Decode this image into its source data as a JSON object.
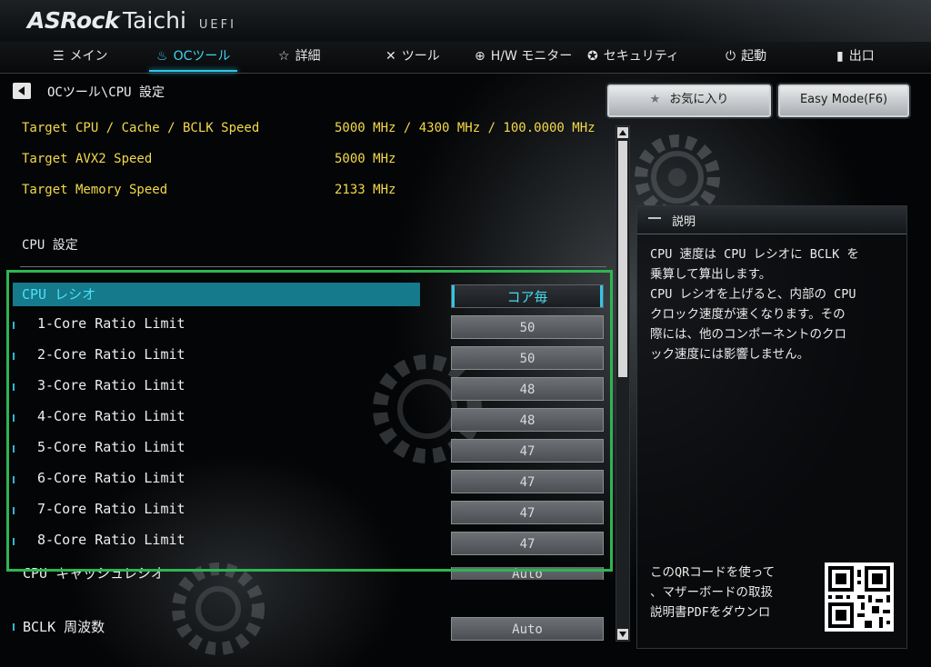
{
  "header": {
    "brand": "ASRock",
    "model": "Taichi",
    "firmware": "UEFI"
  },
  "nav": {
    "tabs": [
      {
        "label": "メイン",
        "icon": "list-icon"
      },
      {
        "label": "OCツール",
        "icon": "flame-icon",
        "active": true
      },
      {
        "label": "詳細",
        "icon": "star-icon"
      },
      {
        "label": "ツール",
        "icon": "tools-icon"
      },
      {
        "label": "H/W モニター",
        "icon": "crosshair-icon"
      },
      {
        "label": "セキュリティ",
        "icon": "shield-icon"
      },
      {
        "label": "起動",
        "icon": "power-icon"
      },
      {
        "label": "出口",
        "icon": "exit-icon"
      }
    ]
  },
  "breadcrumb": "OCツール\\CPU 設定",
  "buttons": {
    "favorites": "お気に入り",
    "easy_mode": "Easy Mode(F6)"
  },
  "info": [
    {
      "label": "Target CPU / Cache / BCLK Speed",
      "value": "5000 MHz / 4300 MHz / 100.0000 MHz"
    },
    {
      "label": "Target AVX2 Speed",
      "value": "5000 MHz"
    },
    {
      "label": "Target Memory Speed",
      "value": "2133 MHz"
    }
  ],
  "section_title": "CPU 設定",
  "settings": [
    {
      "label": "CPU レシオ",
      "value": "コア毎"
    },
    {
      "label": "1-Core Ratio Limit",
      "value": "50"
    },
    {
      "label": "2-Core Ratio Limit",
      "value": "50"
    },
    {
      "label": "3-Core Ratio Limit",
      "value": "48"
    },
    {
      "label": "4-Core Ratio Limit",
      "value": "48"
    },
    {
      "label": "5-Core Ratio Limit",
      "value": "47"
    },
    {
      "label": "6-Core Ratio Limit",
      "value": "47"
    },
    {
      "label": "7-Core Ratio Limit",
      "value": "47"
    },
    {
      "label": "8-Core Ratio Limit",
      "value": "47"
    },
    {
      "label": "CPU キャッシュレシオ",
      "value": "Auto"
    },
    {
      "label": "BCLK 周波数",
      "value": "Auto"
    }
  ],
  "description": {
    "title": "説明",
    "text": "CPU 速度は CPU レシオに BCLK を\n乗算して算出します。\nCPU レシオを上げると、内部の CPU\nクロック速度が速くなります。その\n際には、他のコンポーネントのクロ\nック速度には影響しません。",
    "qr_text": "このQRコードを使って\n、マザーボードの取扱\n説明書PDFをダウンロ"
  },
  "colors": {
    "accent": "#2fc7e8",
    "info_text": "#f2d94b",
    "selected_row": "#157a8c",
    "highlight_box": "#2eb552"
  }
}
